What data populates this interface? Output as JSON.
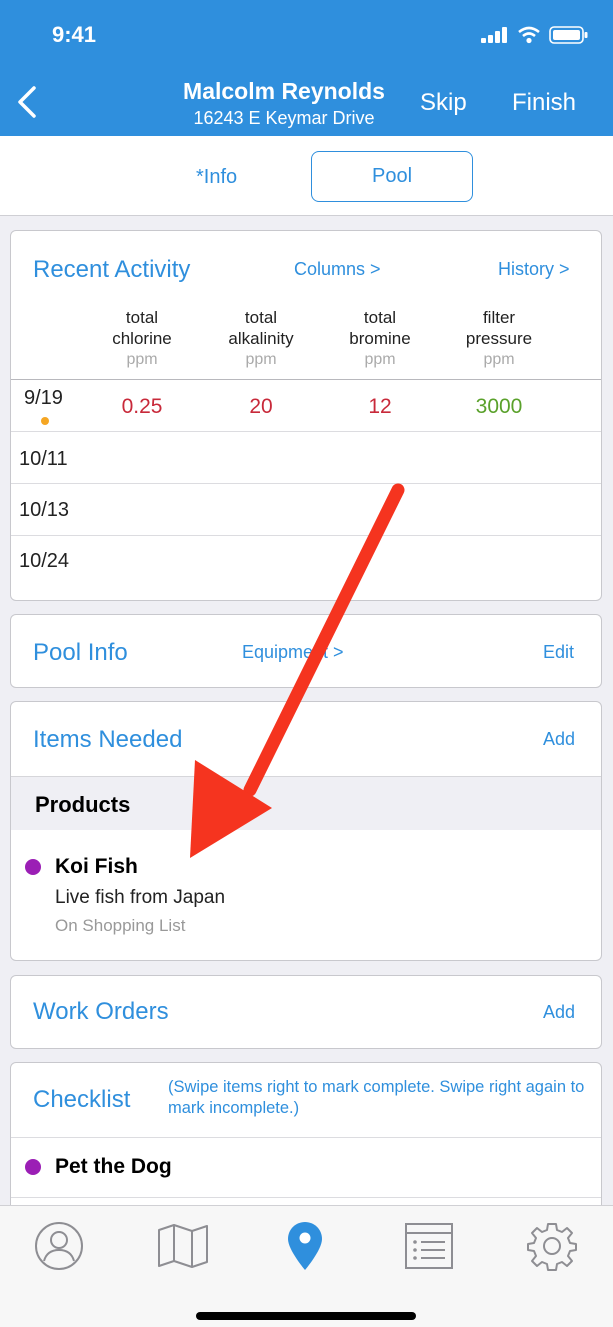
{
  "status_bar": {
    "time": "9:41"
  },
  "header": {
    "title": "Malcolm Reynolds",
    "subtitle": "16243 E Keymar Drive",
    "skip_label": "Skip",
    "finish_label": "Finish"
  },
  "tabs": {
    "info_label": "*Info",
    "pool_label": "Pool"
  },
  "recent_activity": {
    "title": "Recent Activity",
    "columns_link": "Columns >",
    "history_link": "History >",
    "columns": [
      {
        "line1": "total",
        "line2": "chlorine",
        "unit": "ppm"
      },
      {
        "line1": "total",
        "line2": "alkalinity",
        "unit": "ppm"
      },
      {
        "line1": "total",
        "line2": "bromine",
        "unit": "ppm"
      },
      {
        "line1": "filter",
        "line2": "pressure",
        "unit": "ppm"
      }
    ],
    "rows": [
      {
        "date": "9/19",
        "values": [
          "0.25",
          "20",
          "12",
          "3000"
        ]
      },
      {
        "date": "10/11",
        "values": [
          "",
          "",
          "",
          ""
        ]
      },
      {
        "date": "10/13",
        "values": [
          "",
          "",
          "",
          ""
        ]
      },
      {
        "date": "10/24",
        "values": [
          "",
          "",
          "",
          ""
        ]
      }
    ]
  },
  "pool_info": {
    "title": "Pool Info",
    "equipment_link": "Equipment >",
    "edit_link": "Edit"
  },
  "items_needed": {
    "title": "Items Needed",
    "add_link": "Add",
    "section_label": "Products",
    "items": [
      {
        "name": "Koi Fish",
        "description": "Live fish from Japan",
        "status": "On Shopping List"
      }
    ]
  },
  "work_orders": {
    "title": "Work Orders",
    "add_link": "Add"
  },
  "checklist": {
    "title": "Checklist",
    "note": "(Swipe items right to mark complete. Swipe right again to mark incomplete.)",
    "items": [
      {
        "name": "Pet the Dog"
      }
    ]
  },
  "bottom_nav": [
    "profile-icon",
    "map-icon",
    "location-pin-icon",
    "list-icon",
    "settings-gear-icon"
  ],
  "colors": {
    "accent": "#2f8fdd",
    "value_red": "#c8293a",
    "value_green": "#5aa12b",
    "status_dot_orange": "#f5a623",
    "item_dot_purple": "#9b1fb5",
    "annotation_arrow": "#f5341f"
  }
}
